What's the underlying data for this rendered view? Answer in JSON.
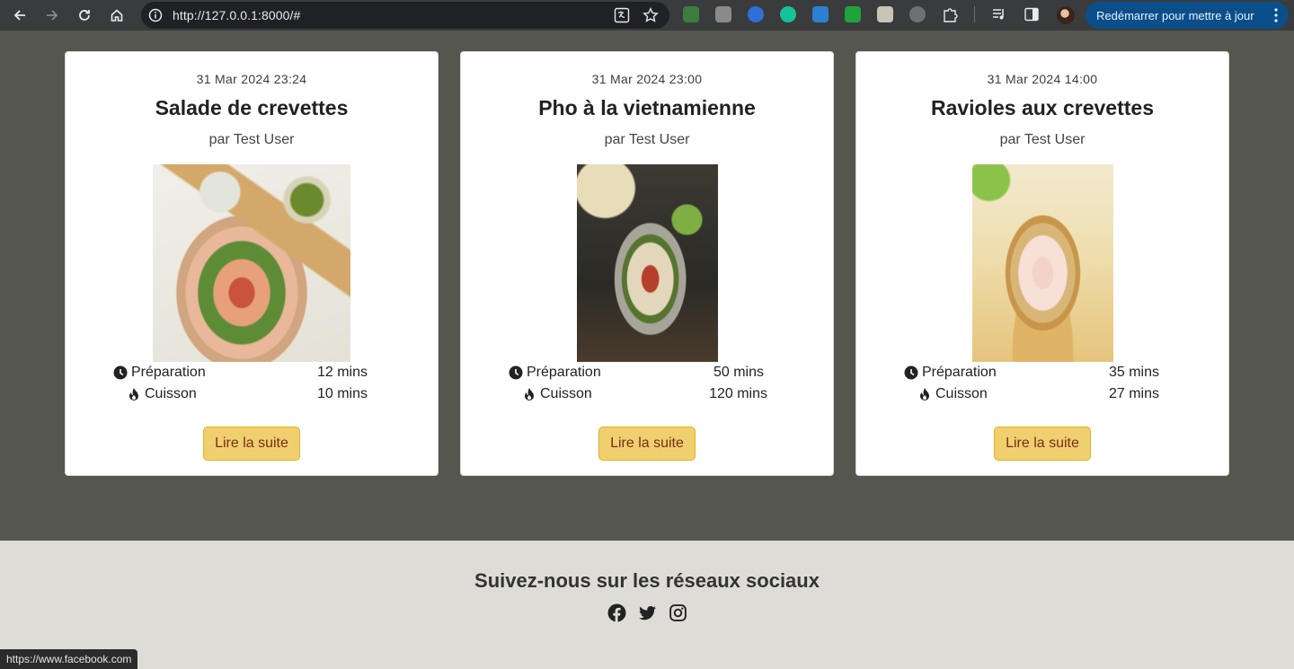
{
  "browser": {
    "url": "http://127.0.0.1:8000/#",
    "update_label": "Redémarrer pour mettre à jour",
    "status_url": "https://www.facebook.com"
  },
  "recipes": [
    {
      "date": "31 Mar 2024 23:24",
      "title": "Salade de crevettes",
      "author": "par Test User",
      "prep_label": "Préparation",
      "prep_value": "12 mins",
      "cook_label": "Cuisson",
      "cook_value": "10 mins",
      "button": "Lire la suite"
    },
    {
      "date": "31 Mar 2024 23:00",
      "title": "Pho à la vietnamienne",
      "author": "par Test User",
      "prep_label": "Préparation",
      "prep_value": "50 mins",
      "cook_label": "Cuisson",
      "cook_value": "120 mins",
      "button": "Lire la suite"
    },
    {
      "date": "31 Mar 2024 14:00",
      "title": "Ravioles aux crevettes",
      "author": "par Test User",
      "prep_label": "Préparation",
      "prep_value": "35 mins",
      "cook_label": "Cuisson",
      "cook_value": "27 mins",
      "button": "Lire la suite"
    }
  ],
  "footer": {
    "title": "Suivez-nous sur les réseaux sociaux",
    "socials": [
      "facebook-icon",
      "twitter-icon",
      "instagram-icon"
    ]
  },
  "colors": {
    "page_bg": "#55564d",
    "footer_bg": "#dddcd7",
    "button_bg": "#f0cf6f",
    "button_text": "#7b2e15",
    "update_btn": "#0b4f8a"
  }
}
